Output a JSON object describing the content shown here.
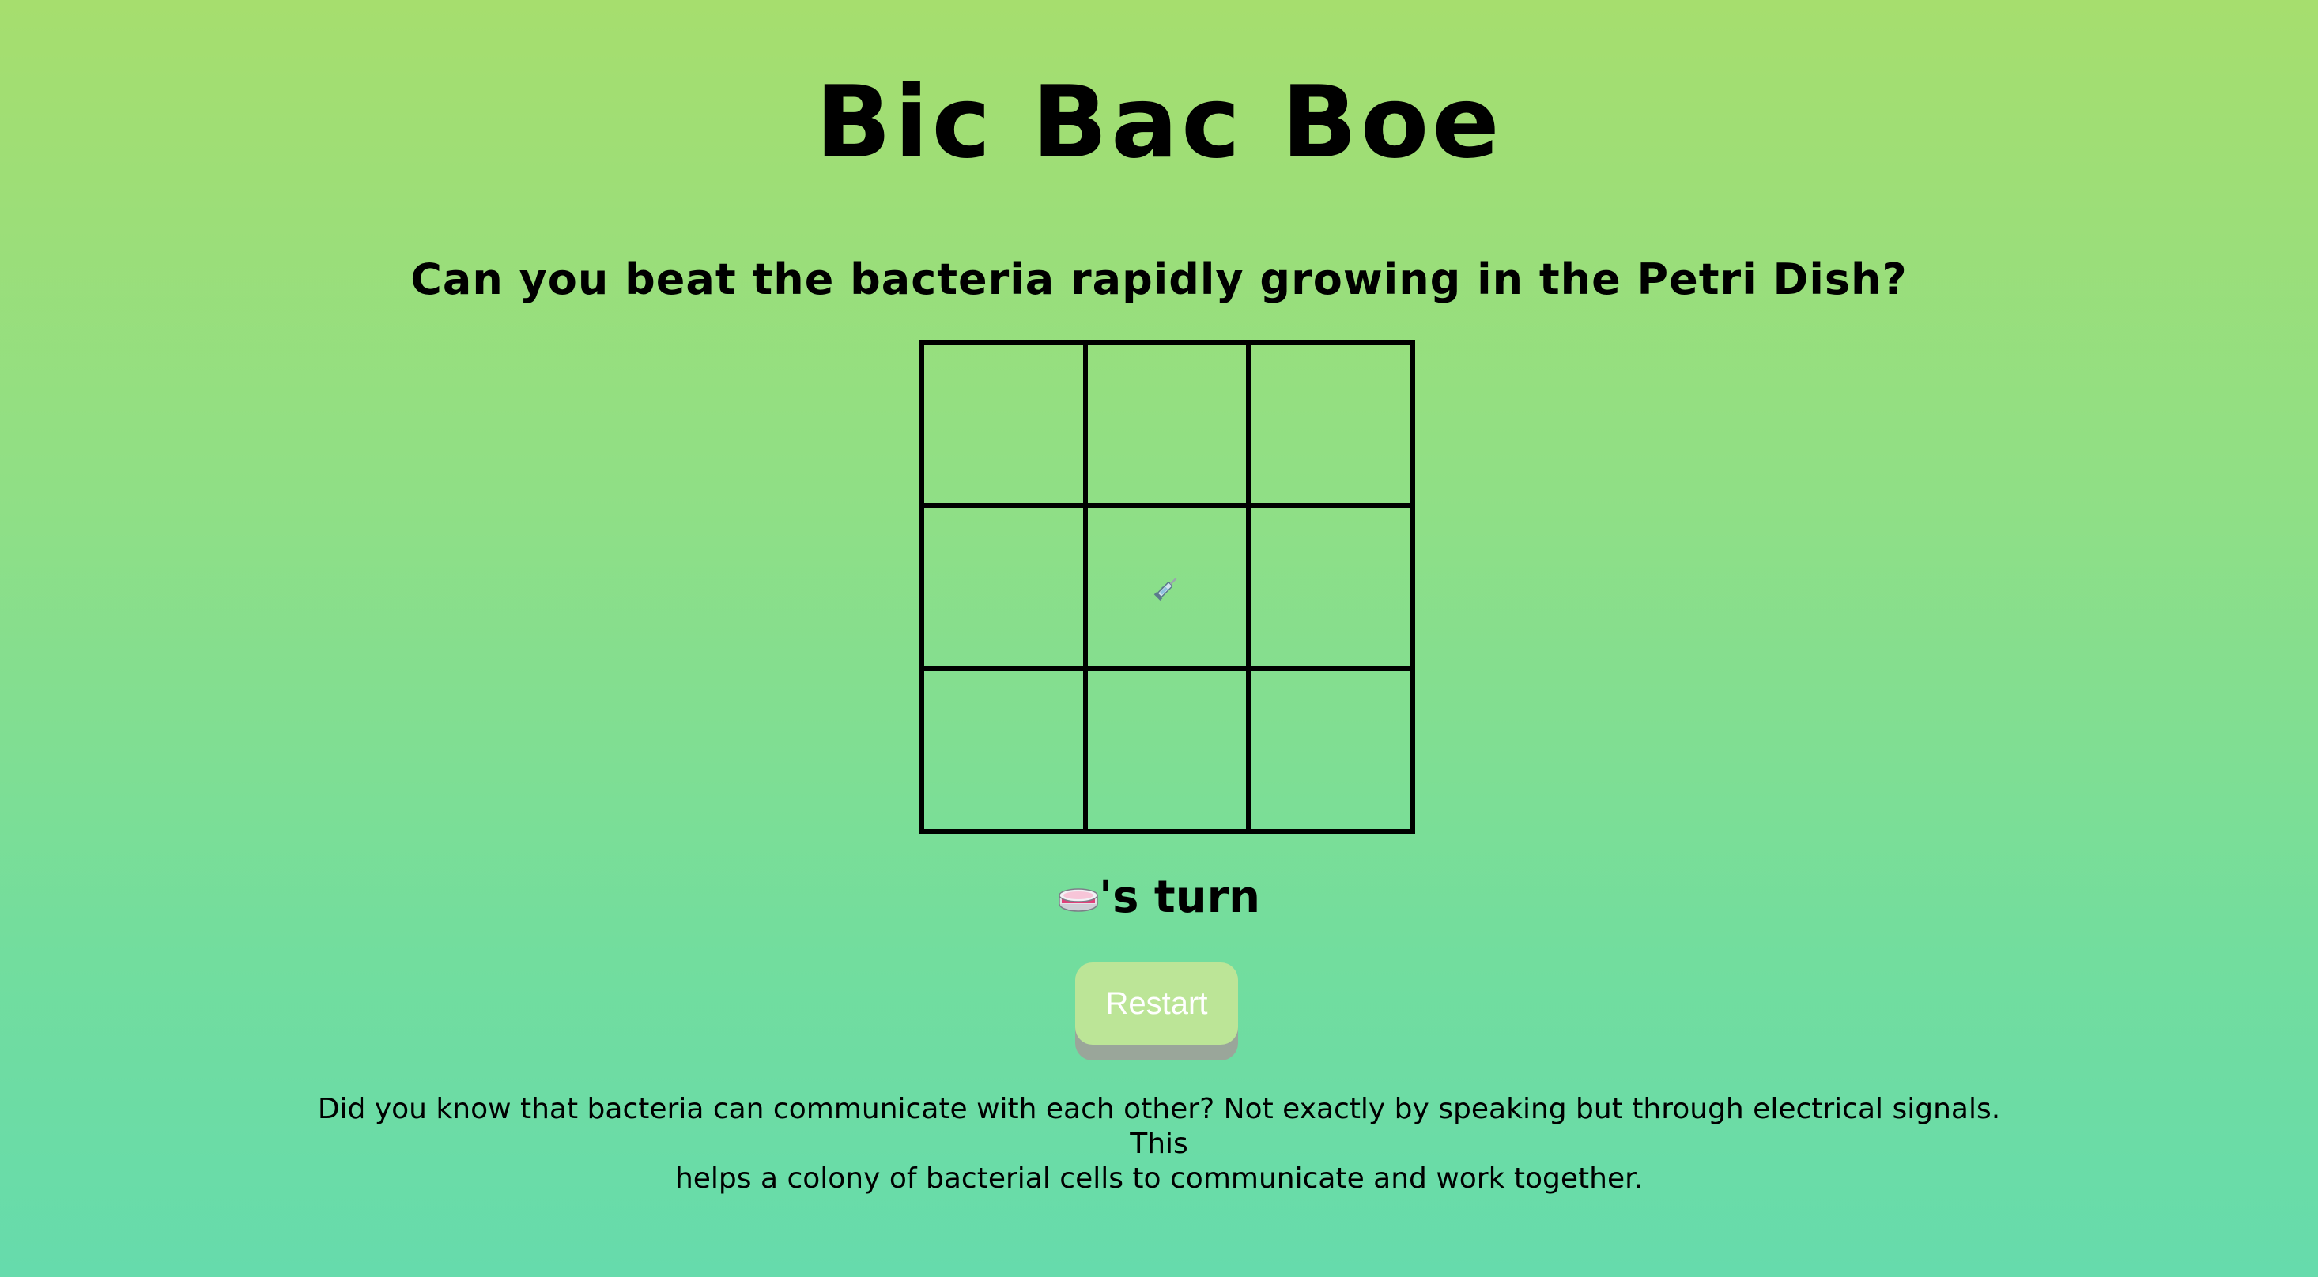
{
  "header": {
    "title": "Bic Bac Boe",
    "subtitle": "Can you beat the bacteria rapidly growing in the Petri Dish?"
  },
  "board": {
    "cells": [
      "",
      "",
      "",
      "",
      "syringe-icon",
      "",
      "",
      "",
      ""
    ]
  },
  "status": {
    "player_icon": "petri-dish-icon",
    "turn_text": "'s turn"
  },
  "controls": {
    "restart_label": "Restart"
  },
  "fact": {
    "line1": "Did you know that bacteria can communicate with each other? Not exactly by speaking but through electrical signals. This",
    "line2": "helps a colony of bacterial cells to communicate and work together."
  },
  "colors": {
    "background_top": "#a6de6e",
    "background_bottom": "#66dbac",
    "restart_button": "#bce597"
  }
}
